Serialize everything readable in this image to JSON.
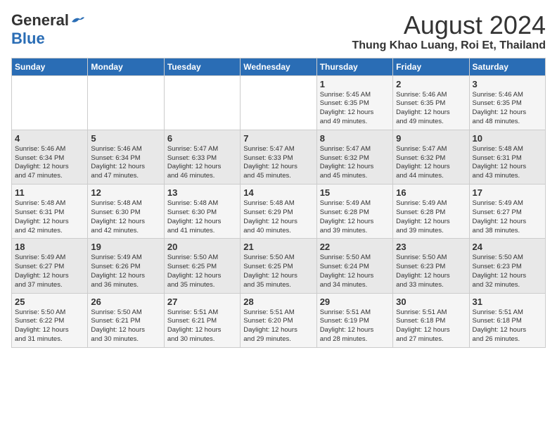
{
  "header": {
    "logo_line1": "General",
    "logo_line2": "Blue",
    "main_title": "August 2024",
    "subtitle": "Thung Khao Luang, Roi Et, Thailand"
  },
  "calendar": {
    "days_of_week": [
      "Sunday",
      "Monday",
      "Tuesday",
      "Wednesday",
      "Thursday",
      "Friday",
      "Saturday"
    ],
    "weeks": [
      [
        {
          "day": "",
          "detail": ""
        },
        {
          "day": "",
          "detail": ""
        },
        {
          "day": "",
          "detail": ""
        },
        {
          "day": "",
          "detail": ""
        },
        {
          "day": "1",
          "detail": "Sunrise: 5:45 AM\nSunset: 6:35 PM\nDaylight: 12 hours\nand 49 minutes."
        },
        {
          "day": "2",
          "detail": "Sunrise: 5:46 AM\nSunset: 6:35 PM\nDaylight: 12 hours\nand 49 minutes."
        },
        {
          "day": "3",
          "detail": "Sunrise: 5:46 AM\nSunset: 6:35 PM\nDaylight: 12 hours\nand 48 minutes."
        }
      ],
      [
        {
          "day": "4",
          "detail": "Sunrise: 5:46 AM\nSunset: 6:34 PM\nDaylight: 12 hours\nand 47 minutes."
        },
        {
          "day": "5",
          "detail": "Sunrise: 5:46 AM\nSunset: 6:34 PM\nDaylight: 12 hours\nand 47 minutes."
        },
        {
          "day": "6",
          "detail": "Sunrise: 5:47 AM\nSunset: 6:33 PM\nDaylight: 12 hours\nand 46 minutes."
        },
        {
          "day": "7",
          "detail": "Sunrise: 5:47 AM\nSunset: 6:33 PM\nDaylight: 12 hours\nand 45 minutes."
        },
        {
          "day": "8",
          "detail": "Sunrise: 5:47 AM\nSunset: 6:32 PM\nDaylight: 12 hours\nand 45 minutes."
        },
        {
          "day": "9",
          "detail": "Sunrise: 5:47 AM\nSunset: 6:32 PM\nDaylight: 12 hours\nand 44 minutes."
        },
        {
          "day": "10",
          "detail": "Sunrise: 5:48 AM\nSunset: 6:31 PM\nDaylight: 12 hours\nand 43 minutes."
        }
      ],
      [
        {
          "day": "11",
          "detail": "Sunrise: 5:48 AM\nSunset: 6:31 PM\nDaylight: 12 hours\nand 42 minutes."
        },
        {
          "day": "12",
          "detail": "Sunrise: 5:48 AM\nSunset: 6:30 PM\nDaylight: 12 hours\nand 42 minutes."
        },
        {
          "day": "13",
          "detail": "Sunrise: 5:48 AM\nSunset: 6:30 PM\nDaylight: 12 hours\nand 41 minutes."
        },
        {
          "day": "14",
          "detail": "Sunrise: 5:48 AM\nSunset: 6:29 PM\nDaylight: 12 hours\nand 40 minutes."
        },
        {
          "day": "15",
          "detail": "Sunrise: 5:49 AM\nSunset: 6:28 PM\nDaylight: 12 hours\nand 39 minutes."
        },
        {
          "day": "16",
          "detail": "Sunrise: 5:49 AM\nSunset: 6:28 PM\nDaylight: 12 hours\nand 39 minutes."
        },
        {
          "day": "17",
          "detail": "Sunrise: 5:49 AM\nSunset: 6:27 PM\nDaylight: 12 hours\nand 38 minutes."
        }
      ],
      [
        {
          "day": "18",
          "detail": "Sunrise: 5:49 AM\nSunset: 6:27 PM\nDaylight: 12 hours\nand 37 minutes."
        },
        {
          "day": "19",
          "detail": "Sunrise: 5:49 AM\nSunset: 6:26 PM\nDaylight: 12 hours\nand 36 minutes."
        },
        {
          "day": "20",
          "detail": "Sunrise: 5:50 AM\nSunset: 6:25 PM\nDaylight: 12 hours\nand 35 minutes."
        },
        {
          "day": "21",
          "detail": "Sunrise: 5:50 AM\nSunset: 6:25 PM\nDaylight: 12 hours\nand 35 minutes."
        },
        {
          "day": "22",
          "detail": "Sunrise: 5:50 AM\nSunset: 6:24 PM\nDaylight: 12 hours\nand 34 minutes."
        },
        {
          "day": "23",
          "detail": "Sunrise: 5:50 AM\nSunset: 6:23 PM\nDaylight: 12 hours\nand 33 minutes."
        },
        {
          "day": "24",
          "detail": "Sunrise: 5:50 AM\nSunset: 6:23 PM\nDaylight: 12 hours\nand 32 minutes."
        }
      ],
      [
        {
          "day": "25",
          "detail": "Sunrise: 5:50 AM\nSunset: 6:22 PM\nDaylight: 12 hours\nand 31 minutes."
        },
        {
          "day": "26",
          "detail": "Sunrise: 5:50 AM\nSunset: 6:21 PM\nDaylight: 12 hours\nand 30 minutes."
        },
        {
          "day": "27",
          "detail": "Sunrise: 5:51 AM\nSunset: 6:21 PM\nDaylight: 12 hours\nand 30 minutes."
        },
        {
          "day": "28",
          "detail": "Sunrise: 5:51 AM\nSunset: 6:20 PM\nDaylight: 12 hours\nand 29 minutes."
        },
        {
          "day": "29",
          "detail": "Sunrise: 5:51 AM\nSunset: 6:19 PM\nDaylight: 12 hours\nand 28 minutes."
        },
        {
          "day": "30",
          "detail": "Sunrise: 5:51 AM\nSunset: 6:18 PM\nDaylight: 12 hours\nand 27 minutes."
        },
        {
          "day": "31",
          "detail": "Sunrise: 5:51 AM\nSunset: 6:18 PM\nDaylight: 12 hours\nand 26 minutes."
        }
      ]
    ]
  }
}
